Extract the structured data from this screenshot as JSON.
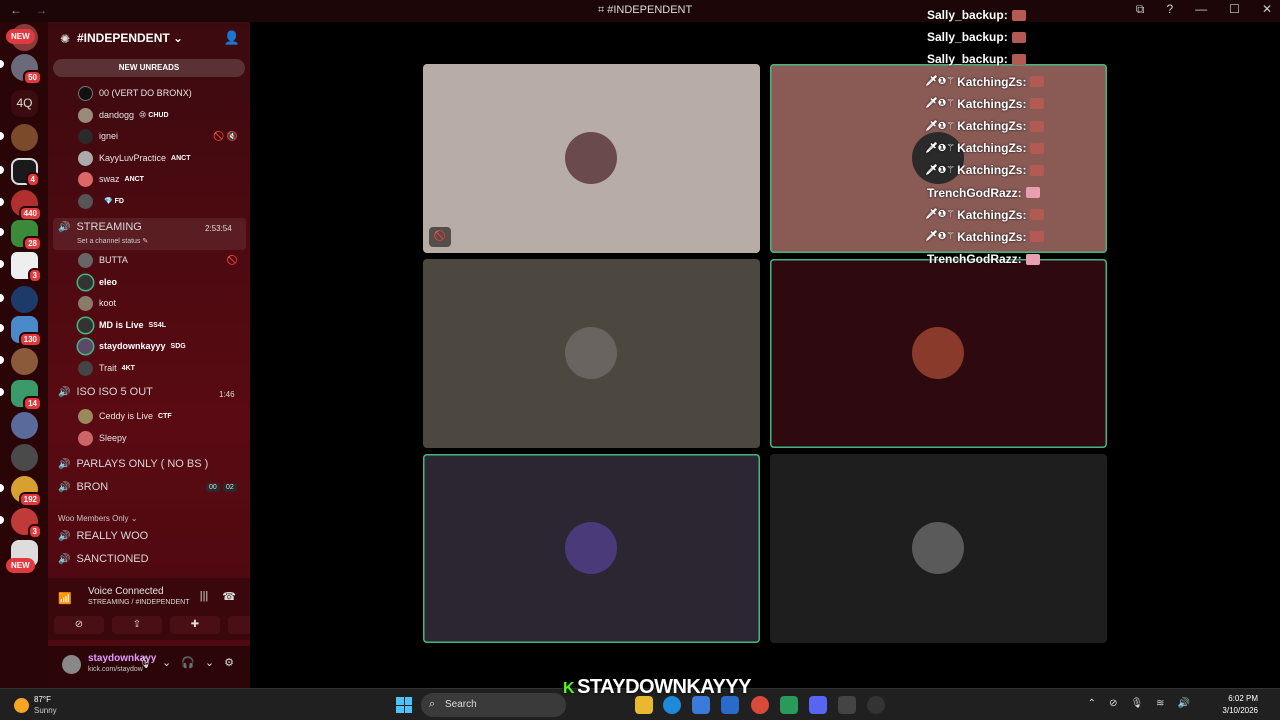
{
  "window": {
    "title": "#INDEPENDENT"
  },
  "rail": {
    "new_top": "NEW",
    "badge_50": "50",
    "server_4q": "4Q",
    "badge_4": "4",
    "badge_440": "440",
    "badge_28": "28",
    "badge_3a": "3",
    "badge_130": "130",
    "badge_14": "14",
    "badge_192": "192",
    "badge_3b": "3",
    "new_bottom": "NEW"
  },
  "sidebar": {
    "guild_name": "#INDEPENDENT",
    "new_unreads": "NEW UNREADS",
    "users_top": [
      {
        "name": "00 (VERT DO BRONX)",
        "tag": ""
      },
      {
        "name": "dandogg",
        "tag": "😢 CHUD"
      },
      {
        "name": "ignei",
        "tag": ""
      },
      {
        "name": "KayyLuvPractice",
        "tag": "ANCT"
      },
      {
        "name": "swaz",
        "tag": "ANCT"
      },
      {
        "name": "",
        "tag": "💎 FD"
      }
    ],
    "streaming": {
      "name": "STREAMING",
      "timer": "2:53:54",
      "status": "Set a channel status ✎"
    },
    "streaming_users": [
      {
        "name": "BUTTA",
        "tag": ""
      },
      {
        "name": "eleo",
        "tag": ""
      },
      {
        "name": "koot",
        "tag": ""
      },
      {
        "name": "MD is Live",
        "tag": "SS4L"
      },
      {
        "name": "staydownkayyy",
        "tag": "SDG"
      },
      {
        "name": "Trait",
        "tag": "4KT"
      }
    ],
    "iso": {
      "name": "ISO ISO 5 OUT",
      "timer": "1:46"
    },
    "iso_users": [
      {
        "name": "Ceddy is Live",
        "tag": "CTF"
      },
      {
        "name": "Sleepy",
        "tag": ""
      }
    ],
    "parlays": "PARLAYS ONLY ( NO BS )",
    "bron": "BRON",
    "bron_count_a": "00",
    "bron_count_b": "02",
    "category": "Woo Members Only ⌄",
    "really_woo": "REALLY WOO",
    "sanctioned": "SANCTIONED"
  },
  "voice": {
    "title": "Voice Connected",
    "subtitle": "STREAMING / #INDEPENDENT"
  },
  "user": {
    "name": "staydownkayy",
    "status": "kick.com/staydow"
  },
  "chat": [
    {
      "badges": "",
      "user": "Sally_backup:"
    },
    {
      "badges": "",
      "user": "Sally_backup:"
    },
    {
      "badges": "",
      "user": "Sally_backup:"
    },
    {
      "badges": "🗡❶⚚",
      "user": "KatchingZs:"
    },
    {
      "badges": "🗡❶⚚",
      "user": "KatchingZs:"
    },
    {
      "badges": "🗡❶⚚",
      "user": "KatchingZs:"
    },
    {
      "badges": "🗡❶⚚",
      "user": "KatchingZs:"
    },
    {
      "badges": "🗡❶⚚",
      "user": "KatchingZs:"
    },
    {
      "badges": "",
      "user": "TrenchGodRazz:"
    },
    {
      "badges": "🗡❶⚚",
      "user": "KatchingZs:"
    },
    {
      "badges": "🗡❶⚚",
      "user": "KatchingZs:"
    },
    {
      "badges": "",
      "user": "TrenchGodRazz:"
    }
  ],
  "overlay": {
    "channel": "STAYDOWNKAYYY"
  },
  "taskbar": {
    "temp": "87°F",
    "condition": "Sunny",
    "search": "Search",
    "time": "6:02 PM",
    "date": "3/10/2026"
  },
  "colors": {
    "accent_red": "#e03a3e",
    "speaking_green": "#43b581",
    "kick_green": "#53fc18",
    "username_purple": "#e29cff"
  }
}
